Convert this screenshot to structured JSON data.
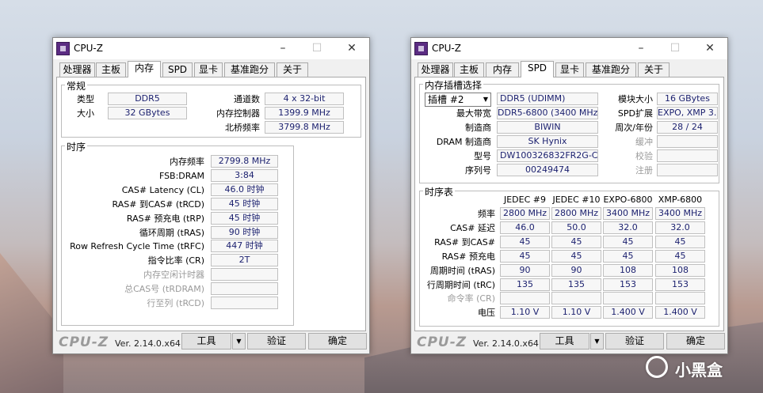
{
  "watermark": "小黑盒",
  "left": {
    "title": "CPU-Z",
    "tabs": [
      "处理器",
      "主板",
      "内存",
      "SPD",
      "显卡",
      "基准跑分",
      "关于"
    ],
    "general": {
      "title": "常规",
      "type_label": "类型",
      "type_value": "DDR5",
      "size_label": "大小",
      "size_value": "32 GBytes",
      "channels_label": "通道数",
      "channels_value": "4 x 32-bit",
      "mc_label": "内存控制器",
      "mc_value": "1399.9 MHz",
      "nb_label": "北桥频率",
      "nb_value": "3799.8 MHz"
    },
    "timings": {
      "title": "时序",
      "rows": [
        {
          "label": "内存频率",
          "value": "2799.8 MHz",
          "disabled": false
        },
        {
          "label": "FSB:DRAM",
          "value": "3:84",
          "disabled": false
        },
        {
          "label": "CAS# Latency (CL)",
          "value": "46.0 时钟",
          "disabled": false
        },
        {
          "label": "RAS# 到CAS# (tRCD)",
          "value": "45 时钟",
          "disabled": false
        },
        {
          "label": "RAS# 预充电 (tRP)",
          "value": "45 时钟",
          "disabled": false
        },
        {
          "label": "循环周期 (tRAS)",
          "value": "90 时钟",
          "disabled": false
        },
        {
          "label": "Row Refresh Cycle Time (tRFC)",
          "value": "447 时钟",
          "disabled": false
        },
        {
          "label": "指令比率 (CR)",
          "value": "2T",
          "disabled": false
        },
        {
          "label": "内存空闲计时器",
          "value": "",
          "disabled": true
        },
        {
          "label": "总CAS号 (tRDRAM)",
          "value": "",
          "disabled": true
        },
        {
          "label": "行至列 (tRCD)",
          "value": "",
          "disabled": true
        }
      ]
    },
    "footer": {
      "logo": "CPU-Z",
      "version": "Ver. 2.14.0.x64",
      "tools": "工具",
      "validate": "验证",
      "ok": "确定"
    }
  },
  "right": {
    "title": "CPU-Z",
    "tabs": [
      "处理器",
      "主板",
      "内存",
      "SPD",
      "显卡",
      "基准跑分",
      "关于"
    ],
    "slot": {
      "title": "内存插槽选择",
      "slot_select": "插槽 #2",
      "type_value": "DDR5 (UDIMM)",
      "module_size_label": "模块大小",
      "module_size_value": "16 GBytes",
      "max_bw_label": "最大带宽",
      "max_bw_value": "DDR5-6800 (3400 MHz)",
      "spd_ext_label": "SPD扩展",
      "spd_ext_value": "EXPO, XMP 3.0",
      "mfr_label": "制造商",
      "mfr_value": "BIWIN",
      "week_label": "周次/年份",
      "week_value": "28 / 24",
      "dram_mfr_label": "DRAM 制造商",
      "dram_mfr_value": "SK Hynix",
      "buffer_label": "缓冲",
      "buffer_value": "",
      "part_label": "型号",
      "part_value": "DW100326832FR2G-CW00",
      "check_label": "校验",
      "check_value": "",
      "serial_label": "序列号",
      "serial_value": "00249474",
      "reg_label": "注册",
      "reg_value": ""
    },
    "timing_table": {
      "title": "时序表",
      "columns": [
        "JEDEC #9",
        "JEDEC #10",
        "EXPO-6800",
        "XMP-6800"
      ],
      "rows": [
        {
          "label": "频率",
          "values": [
            "2800 MHz",
            "2800 MHz",
            "3400 MHz",
            "3400 MHz"
          ],
          "disabled": false
        },
        {
          "label": "CAS# 延迟",
          "values": [
            "46.0",
            "50.0",
            "32.0",
            "32.0"
          ],
          "disabled": false
        },
        {
          "label": "RAS# 到CAS#",
          "values": [
            "45",
            "45",
            "45",
            "45"
          ],
          "disabled": false
        },
        {
          "label": "RAS# 预充电",
          "values": [
            "45",
            "45",
            "45",
            "45"
          ],
          "disabled": false
        },
        {
          "label": "周期时间 (tRAS)",
          "values": [
            "90",
            "90",
            "108",
            "108"
          ],
          "disabled": false
        },
        {
          "label": "行周期时间 (tRC)",
          "values": [
            "135",
            "135",
            "153",
            "153"
          ],
          "disabled": false
        },
        {
          "label": "命令率 (CR)",
          "values": [
            "",
            "",
            "",
            ""
          ],
          "disabled": true
        },
        {
          "label": "电压",
          "values": [
            "1.10 V",
            "1.10 V",
            "1.400 V",
            "1.400 V"
          ],
          "disabled": false
        }
      ]
    },
    "footer": {
      "logo": "CPU-Z",
      "version": "Ver. 2.14.0.x64",
      "tools": "工具",
      "validate": "验证",
      "ok": "确定"
    }
  }
}
